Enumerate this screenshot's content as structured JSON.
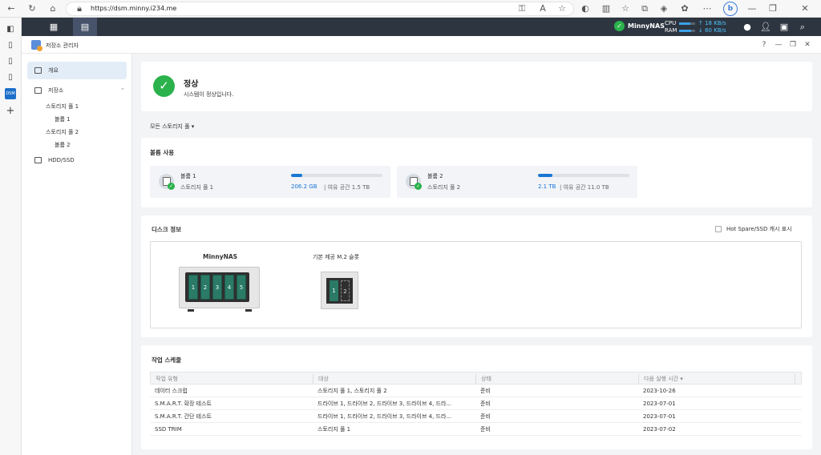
{
  "browser": {
    "url": "https://dsm.minny.i234.me"
  },
  "topbar": {
    "host_name": "MinnyNAS",
    "cpu_label": "CPU",
    "ram_label": "RAM",
    "cpu_rate": "18 KB/s",
    "ram_rate": "60 KB/s",
    "cpu_level": 0.7,
    "ram_level": 0.75
  },
  "window": {
    "title": "저장소 관리자",
    "help": "?"
  },
  "nav": {
    "overview": "개요",
    "storage": "저장소",
    "pool1": "스토리지 풀 1",
    "vol1": "볼륨 1",
    "pool2": "스토리지 풀 2",
    "vol2": "볼륨 2",
    "hdd": "HDD/SSD"
  },
  "status": {
    "title": "정상",
    "desc": "시스템이 정상입니다."
  },
  "filter": {
    "label": "모든 스토리지 풀 ▾"
  },
  "volume_usage": {
    "title": "볼륨 사용",
    "volumes": [
      {
        "name": "볼륨 1",
        "pool": "스토리지 풀 1",
        "used": "206.2 GB",
        "free": "| 여유 공간 1.5 TB",
        "level": 0.12
      },
      {
        "name": "볼륨 2",
        "pool": "스토리지 풀 2",
        "used": "2.1 TB",
        "free": "| 여유 공간 11.0 TB",
        "level": 0.16
      }
    ]
  },
  "disk_info": {
    "title": "디스크 정보",
    "hotspare_label": "Hot Spare/SSD 캐시 표시",
    "nas_name": "MinnyNAS",
    "bays": [
      "1",
      "2",
      "3",
      "4",
      "5"
    ],
    "m2_title": "기본 제공 M.2 슬롯",
    "m2_slots": [
      "1",
      "2"
    ]
  },
  "schedule": {
    "title": "작업 스케줄",
    "headers": [
      "작업 유형",
      "대상",
      "상태",
      "다음 실행 시간 ▾"
    ],
    "rows": [
      [
        "데이터 스크럽",
        "스토리지 풀 1, 스토리지 풀 2",
        "준비",
        "2023-10-26"
      ],
      [
        "S.M.A.R.T. 확장 테스트",
        "드라이브 1, 드라이브 2, 드라이브 3, 드라이브 4, 드라...",
        "준비",
        "2023-07-01"
      ],
      [
        "S.M.A.R.T. 간단 테스트",
        "드라이브 1, 드라이브 2, 드라이브 3, 드라이브 4, 드라...",
        "준비",
        "2023-07-01"
      ],
      [
        "SSD TRIM",
        "스토리지 풀 1",
        "준비",
        "2023-07-02"
      ]
    ]
  }
}
